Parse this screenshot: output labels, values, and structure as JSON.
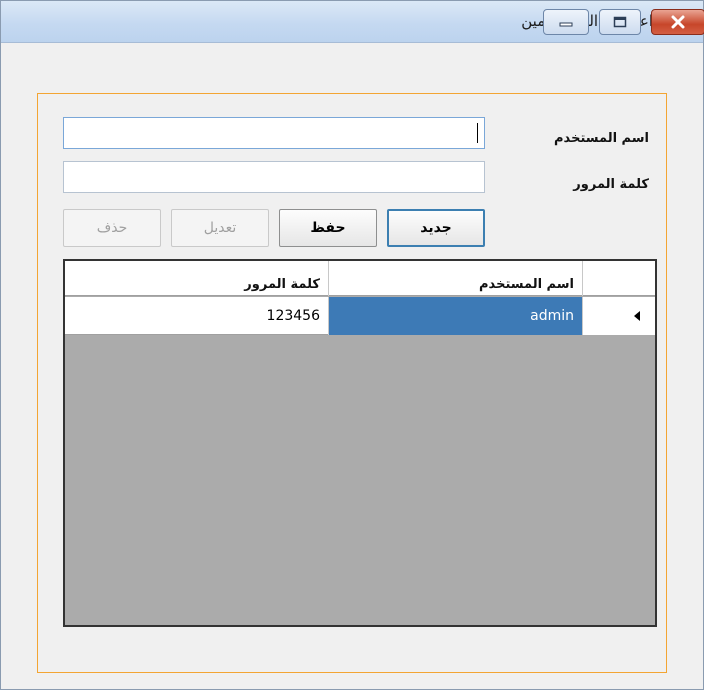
{
  "window": {
    "title": "اعدادات المستخدمين",
    "controls": {
      "minimize": "minimize",
      "maximize": "maximize",
      "close": "close"
    }
  },
  "form": {
    "username_label": "اسم المستخدم",
    "password_label": "كلمة المرور",
    "username_value": "",
    "password_value": ""
  },
  "buttons": {
    "new": "جديد",
    "save": "حفظ",
    "edit": "تعديل",
    "delete": "حذف"
  },
  "grid": {
    "columns": [
      "اسم المستخدم",
      "كلمة المرور"
    ],
    "rows": [
      {
        "username": "admin",
        "password": "123456"
      }
    ]
  },
  "colors": {
    "panel_border": "#f3a533",
    "selection": "#3d7ab6",
    "grid_background": "#ababab"
  }
}
